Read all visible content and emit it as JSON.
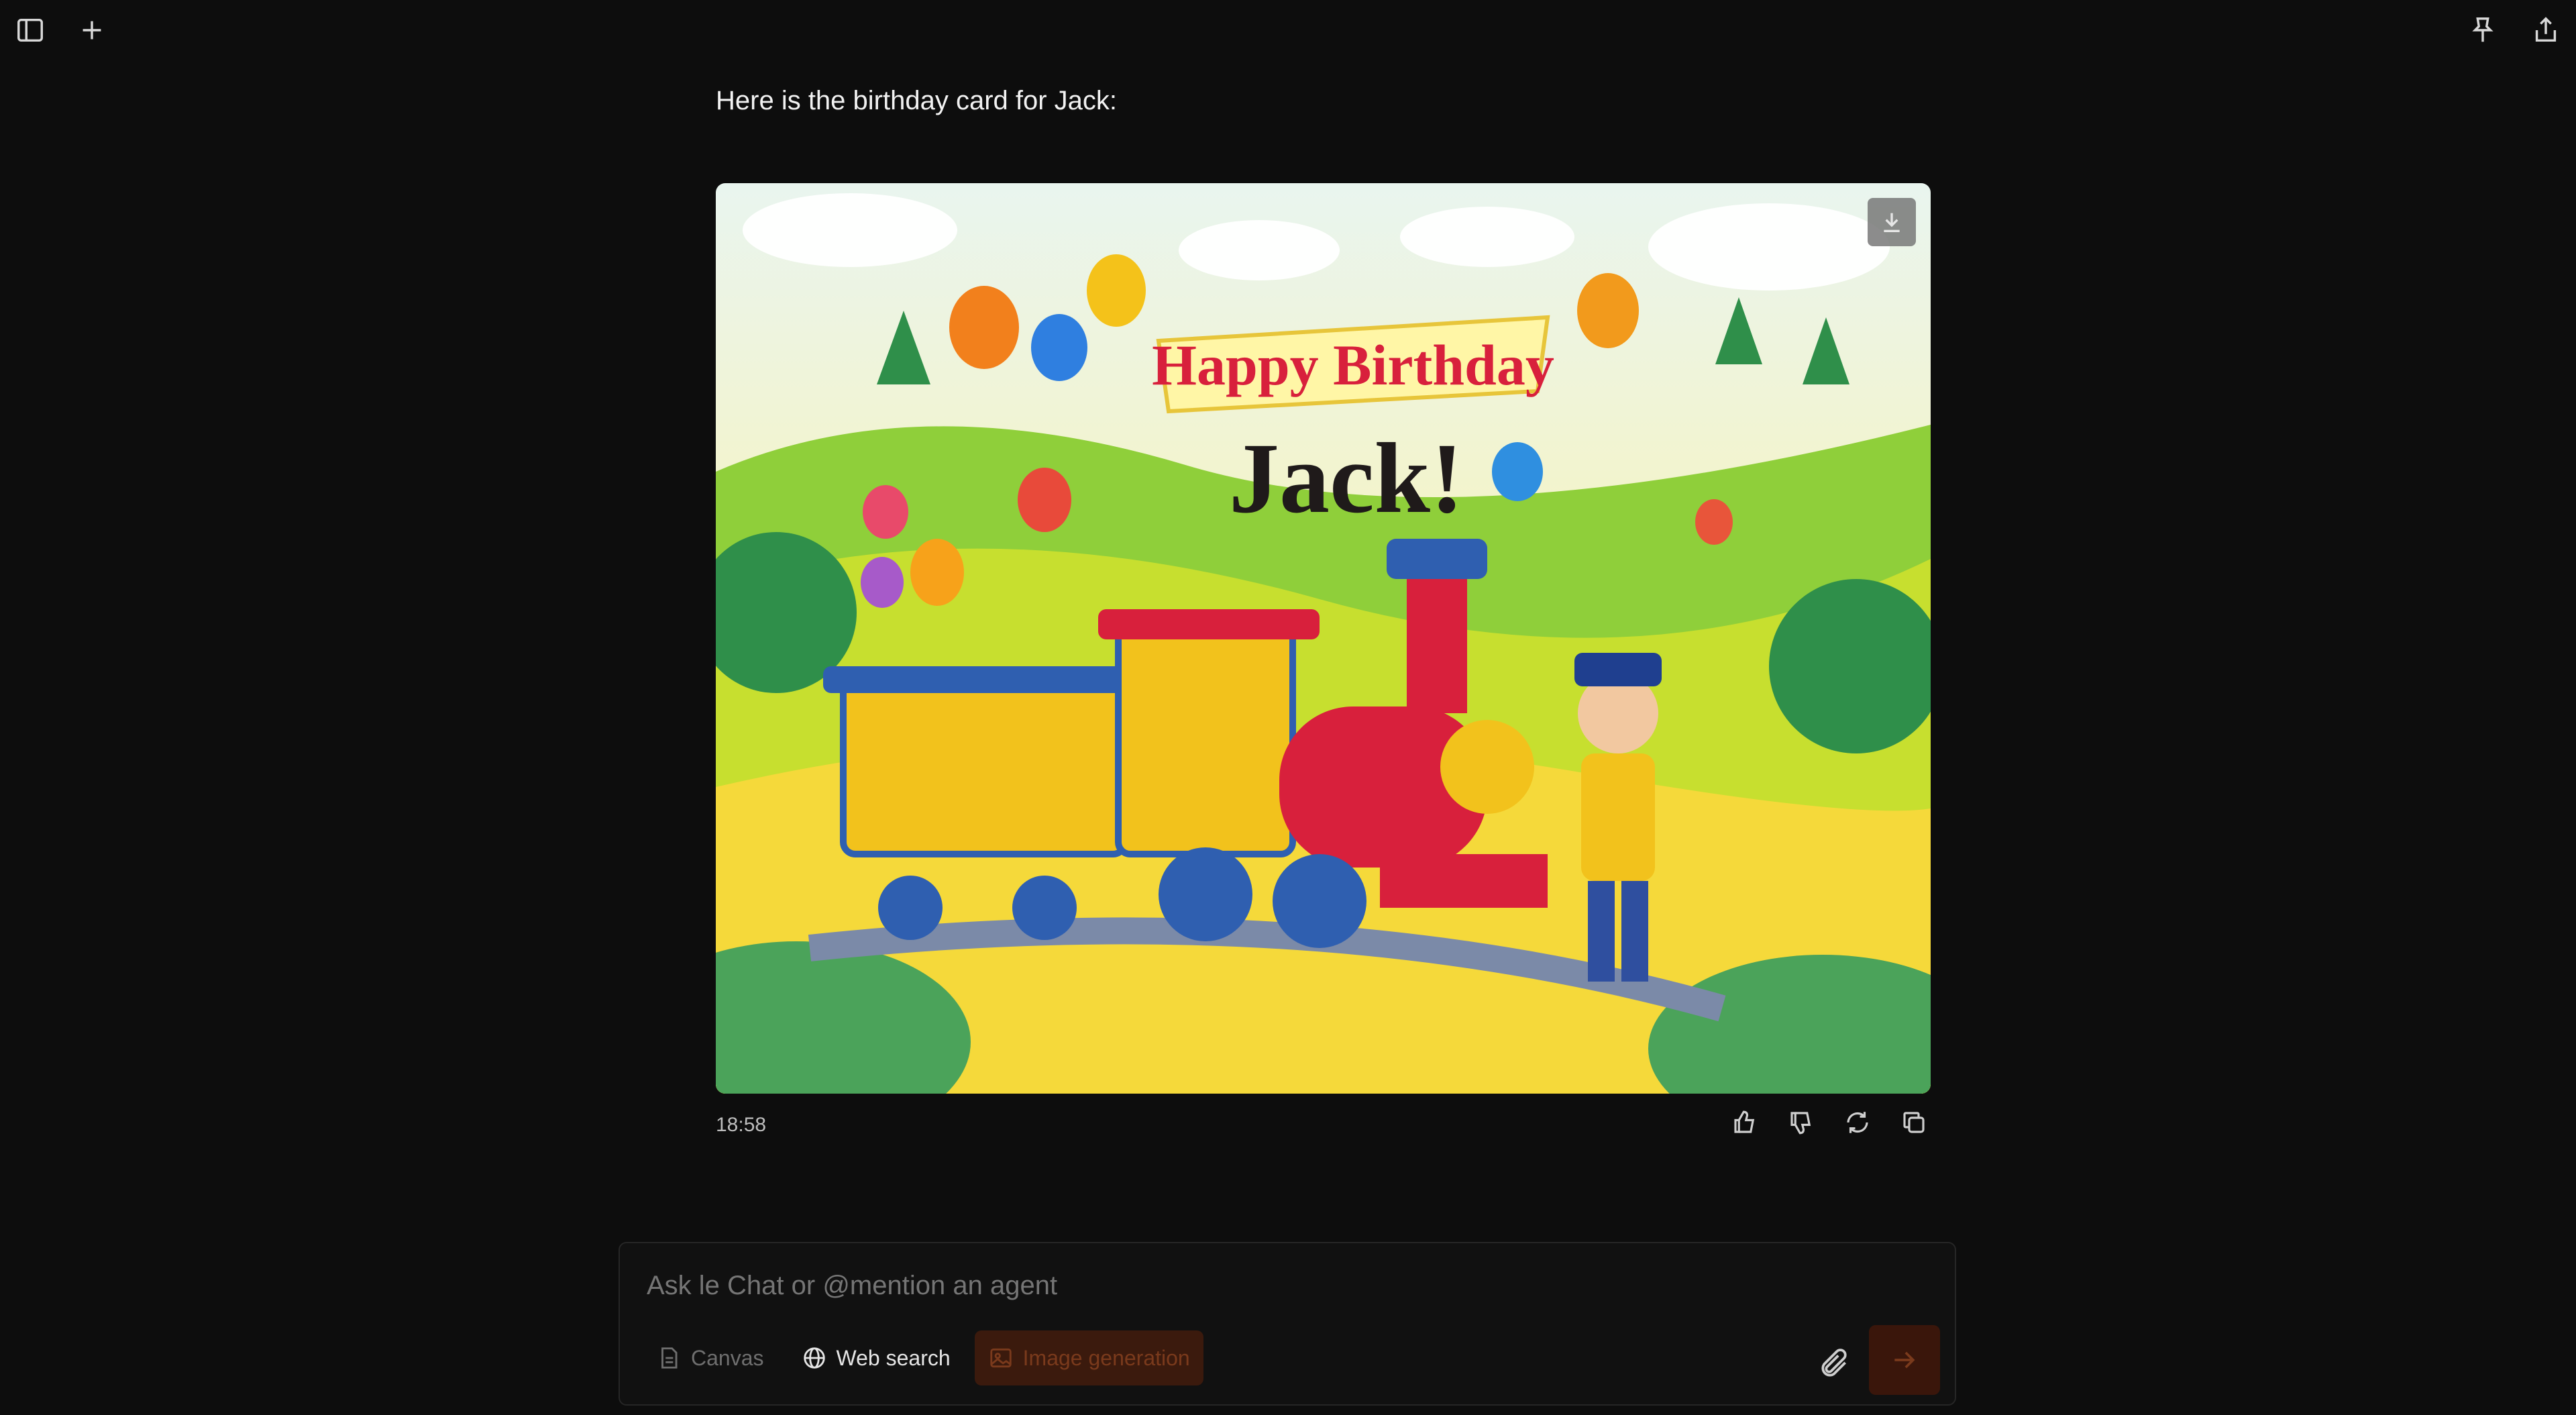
{
  "topbar": {
    "left_icons": [
      "sidebar-toggle-icon",
      "plus-icon"
    ],
    "right_icons": [
      "pin-icon",
      "share-icon"
    ]
  },
  "message": {
    "text": "Here is the birthday card for Jack:",
    "image": {
      "banner_text": "Happy Birthday",
      "name_text": "Jack!"
    },
    "timestamp": "18:58",
    "actions": [
      "thumbs-up-icon",
      "thumbs-down-icon",
      "regenerate-icon",
      "copy-icon"
    ]
  },
  "composer": {
    "placeholder": "Ask le Chat or @mention an agent",
    "tools": [
      {
        "label": "Canvas",
        "icon": "document-icon",
        "state": "disabled"
      },
      {
        "label": "Web search",
        "icon": "globe-icon",
        "state": "enabled"
      },
      {
        "label": "Image generation",
        "icon": "image-icon",
        "state": "active"
      }
    ]
  },
  "colors": {
    "accent": "#ff6a1a",
    "background": "#0d0d0d"
  }
}
